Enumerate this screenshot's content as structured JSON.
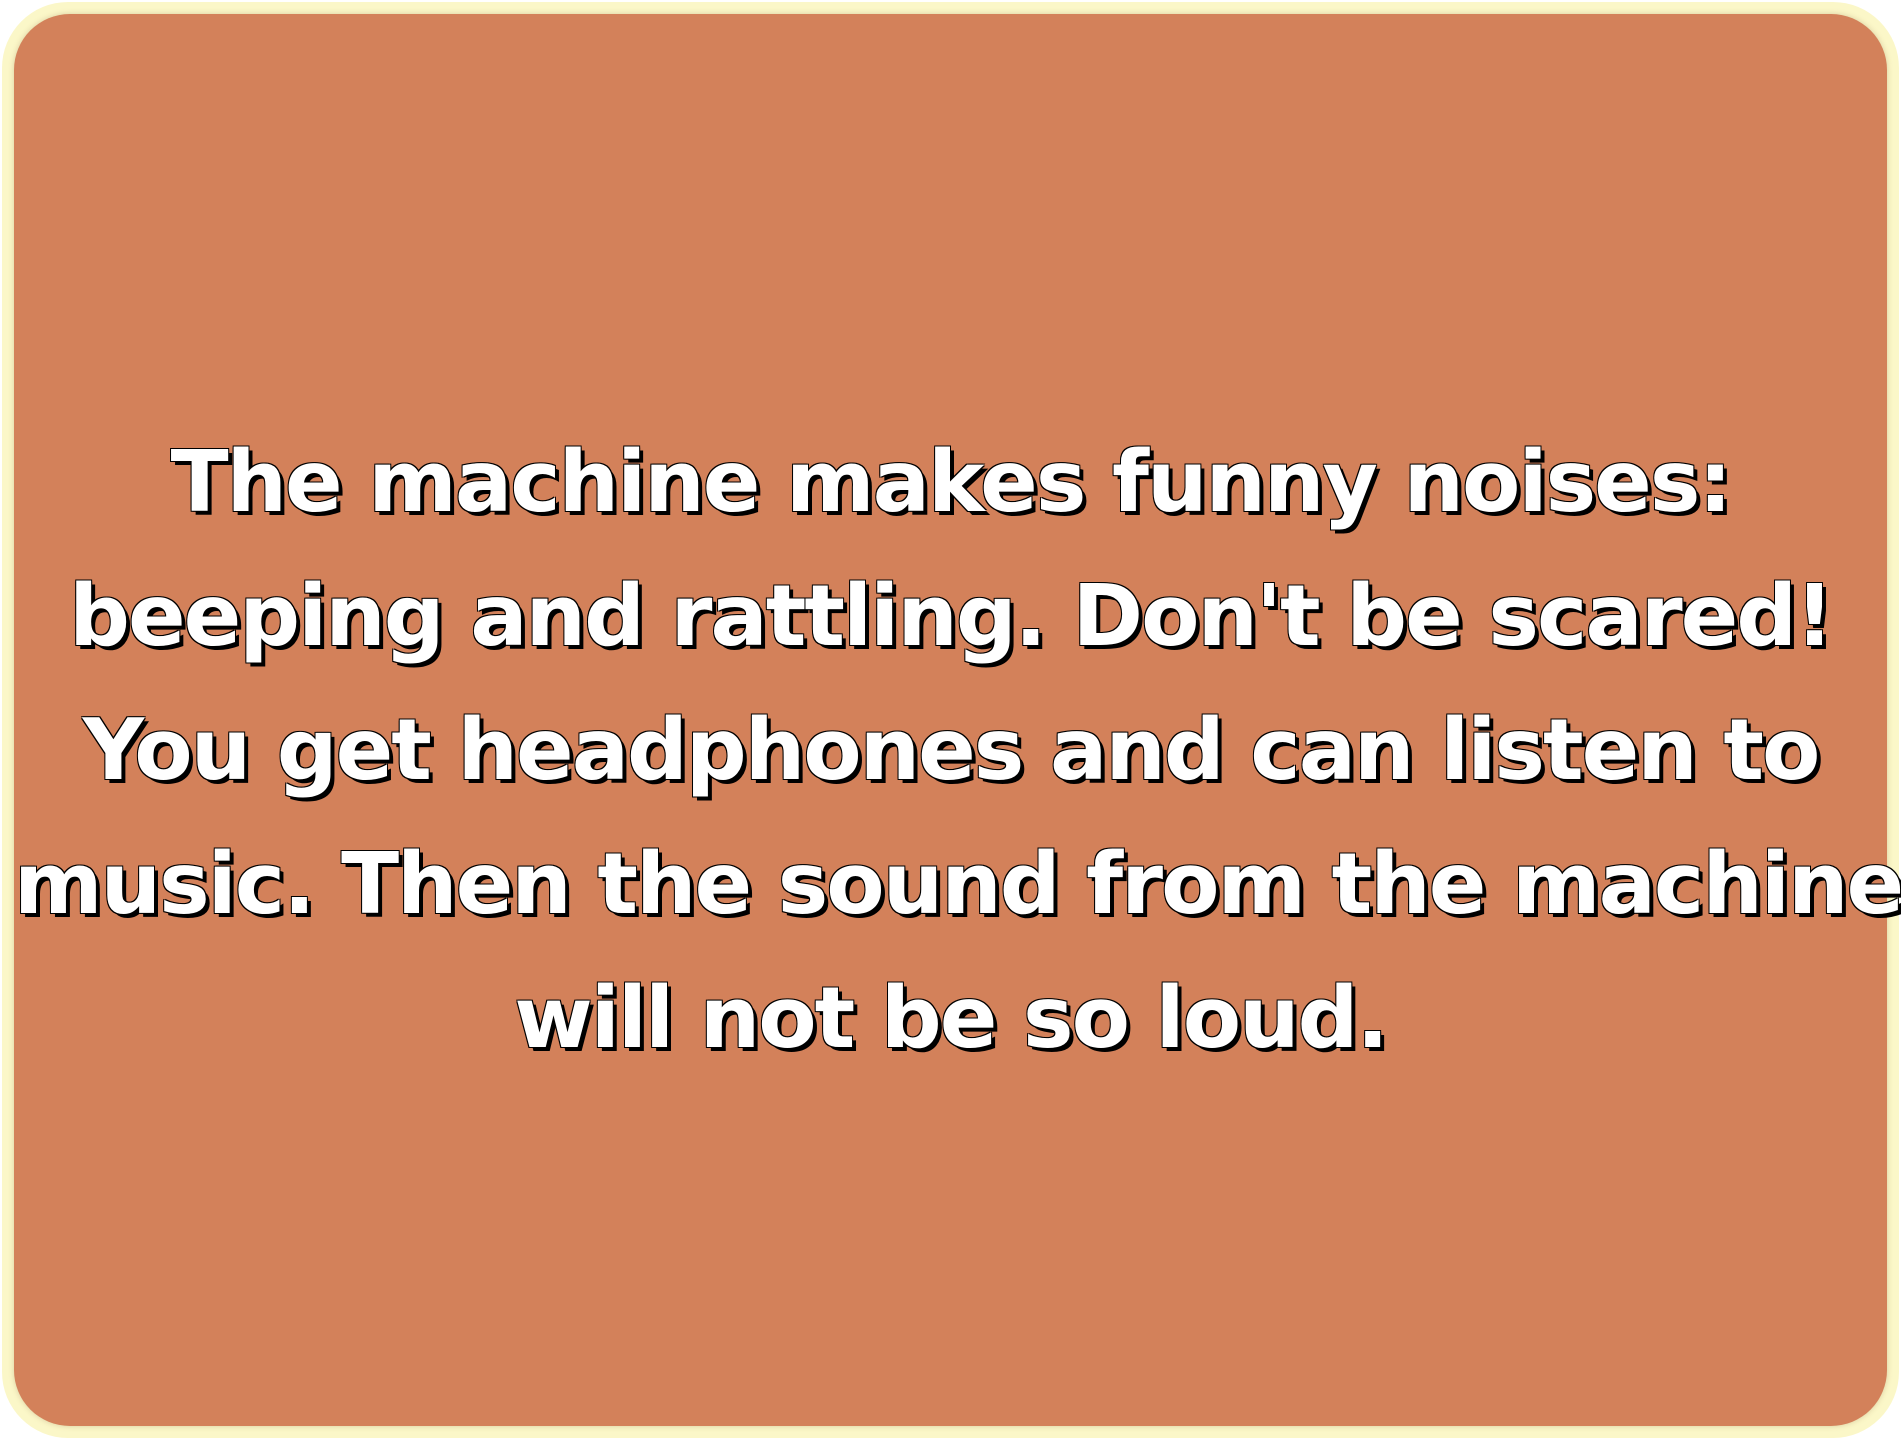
{
  "colors": {
    "border": "#fbf7c8",
    "background": "#d3815a",
    "text": "#ffffff",
    "text_outline": "#000000"
  },
  "message": {
    "lines": [
      "The machine makes funny noises:",
      "beeping and rattling. Don't be scared!",
      "You get headphones and can listen to",
      "music. Then the sound from the machine",
      "will not be so loud."
    ]
  }
}
